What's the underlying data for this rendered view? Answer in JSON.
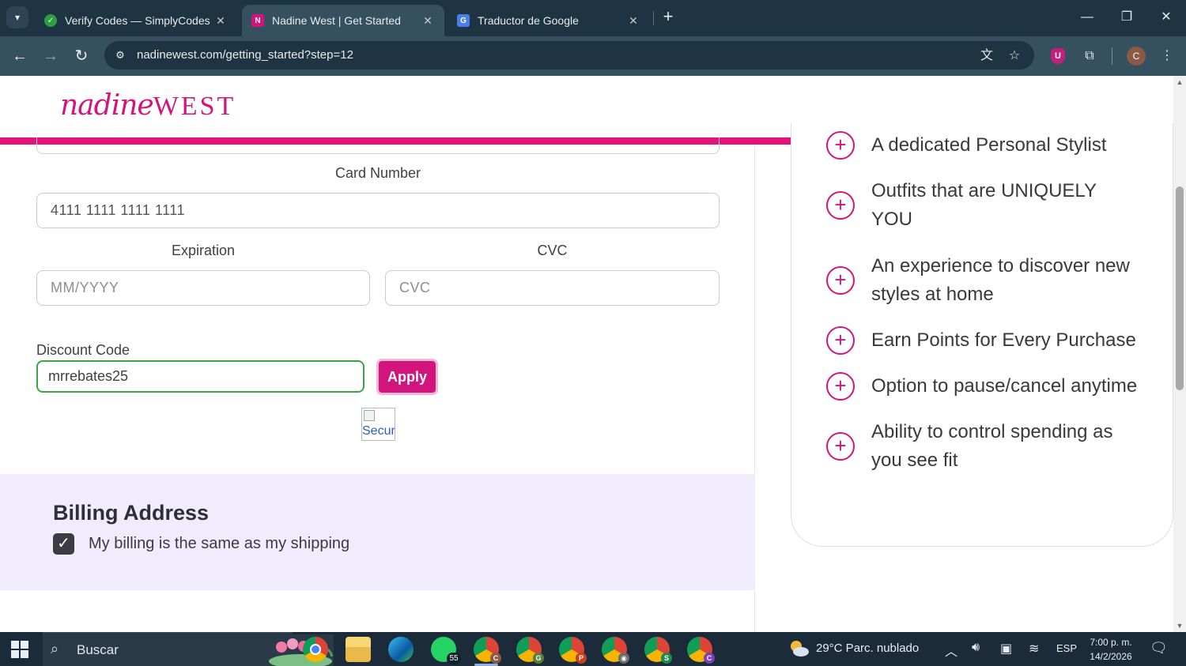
{
  "browser": {
    "tabs": [
      {
        "title": "Verify Codes — SimplyCodes",
        "active": false
      },
      {
        "title": "Nadine West | Get Started",
        "active": true
      },
      {
        "title": "Traductor de Google",
        "active": false
      }
    ],
    "url": "nadinewest.com/getting_started?step=12",
    "profile_initial": "C",
    "extension_badge": "U"
  },
  "site": {
    "logo_script": "nadine",
    "logo_caps": "WEST"
  },
  "payment": {
    "card_number_label": "Card Number",
    "card_number_value": "4111 1111 1111 1111",
    "expiration_label": "Expiration",
    "expiration_placeholder": "MM/YYYY",
    "cvc_label": "CVC",
    "cvc_placeholder": "CVC",
    "discount_label": "Discount Code",
    "discount_value": "mrrebates25",
    "apply_label": "Apply",
    "secure_alt": "Secure"
  },
  "billing": {
    "title": "Billing Address",
    "same_as_shipping_label": "My billing is the same as my shipping",
    "same_as_shipping_checked": true
  },
  "benefits": [
    "A dedicated Personal Stylist",
    "Outfits that are UNIQUELY YOU",
    "An experience to discover new styles at home",
    "Earn Points for Every Purchase",
    "Option to pause/cancel anytime",
    "Ability to control spending as you see fit"
  ],
  "taskbar": {
    "search_label": "Buscar",
    "whatsapp_badge": "55",
    "weather": "29°C  Parc. nublado",
    "language": "ESP",
    "time": "7:00 p. m.",
    "date": "14/2/2026"
  },
  "colors": {
    "brand_pink": "#d3147c",
    "valid_green": "#38a743",
    "billing_bg": "#f1ecfb"
  }
}
